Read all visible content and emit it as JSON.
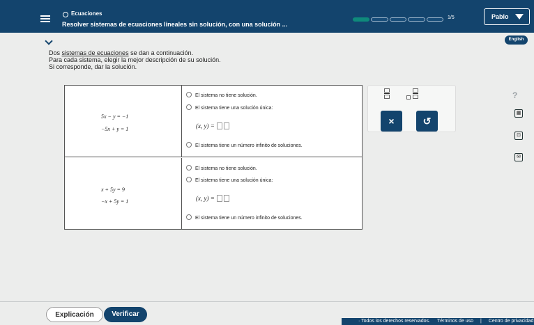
{
  "header": {
    "topic": "Ecuaciones",
    "title": "Resolver sistemas de ecuaciones lineales sin solución, con una solución ...",
    "progress": {
      "current": 1,
      "total": 5,
      "label": "1/5"
    },
    "user": "Pablo"
  },
  "language_button": "English",
  "instructions": {
    "line1_prefix": "Dos ",
    "line1_link": "sistemas de ecuaciones",
    "line1_suffix": " se dan a continuación.",
    "line2": "Para cada sistema, elegir la mejor descripción de su solución.",
    "line3": "Si corresponde, dar la solución."
  },
  "systems": [
    {
      "eq1": "5x − y = −1",
      "eq2": "−5x + y = 1",
      "options": {
        "none": "El sistema no tiene solución.",
        "one": "El sistema tiene una solución única:",
        "pair": "(x, y) =",
        "inf": "El sistema tiene un número infinito de soluciones."
      }
    },
    {
      "eq1": "x + 5y = 9",
      "eq2": "−x + 5y = 1",
      "options": {
        "none": "El sistema no tiene solución.",
        "one": "El sistema tiene una solución única:",
        "pair": "(x, y) =",
        "inf": "El sistema tiene un número infinito de soluciones."
      }
    }
  ],
  "toolbox": {
    "clear": "×",
    "undo": "↺"
  },
  "side_tools": {
    "help": "?"
  },
  "buttons": {
    "explanation": "Explicación",
    "verify": "Verificar"
  },
  "footer": {
    "rights": "· Todos los derechos reservados.",
    "terms": "Términos de uso",
    "privacy": "Centro de privacidad"
  }
}
